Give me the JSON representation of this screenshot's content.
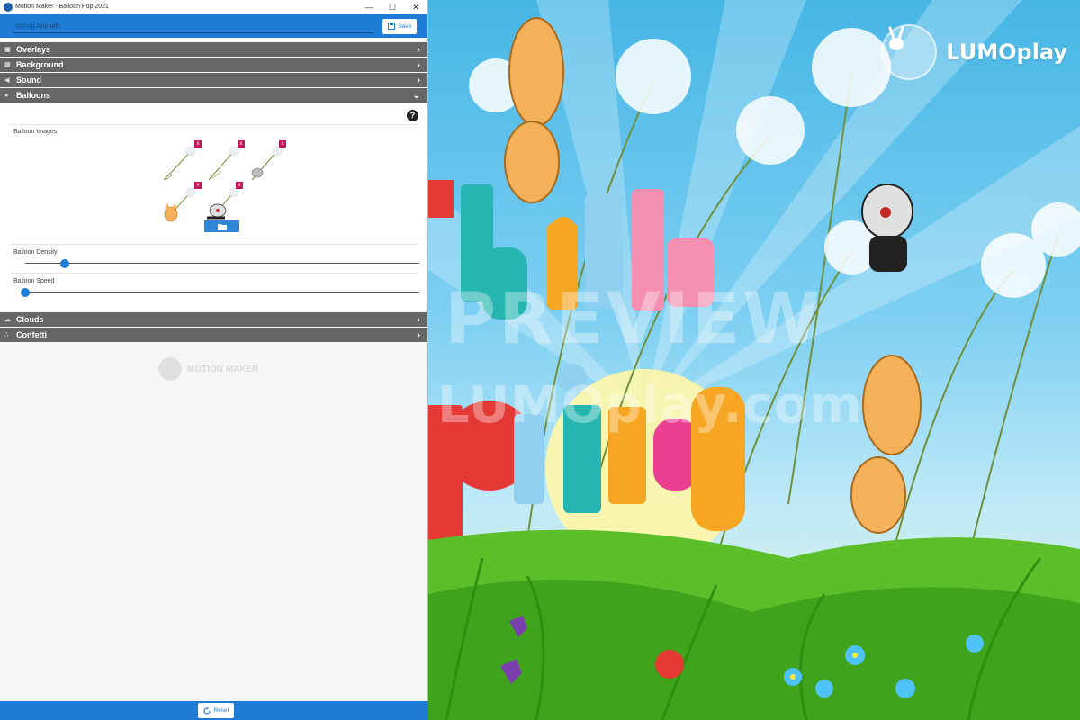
{
  "window": {
    "title": "Motion Maker - Balloon Pop 2021",
    "minimize": "—",
    "maximize": "☐",
    "close": "✕"
  },
  "topbar": {
    "name_value": "Spring Animals",
    "save_label": "Save"
  },
  "sections": {
    "overlays": "Overlays",
    "background": "Background",
    "sound": "Sound",
    "balloons": "Balloons",
    "clouds": "Clouds",
    "confetti": "Confetti"
  },
  "balloons": {
    "help": "?",
    "images_label": "Balloon Images",
    "delete_glyph": "x",
    "density_label": "Balloon Density",
    "density_value": 0.1,
    "speed_label": "Balloon Speed",
    "speed_value": 0.0
  },
  "watermark": {
    "motion_maker": "MOTION MAKER"
  },
  "footer": {
    "reset_label": "Reset"
  },
  "preview": {
    "logo_text": "LUMOplay",
    "watermark_main": "PREVIEW",
    "watermark_url": "LUMOplay.com"
  },
  "colors": {
    "accent": "#1e7bd6",
    "section_header": "#666666",
    "delete_badge": "#c2185b"
  }
}
